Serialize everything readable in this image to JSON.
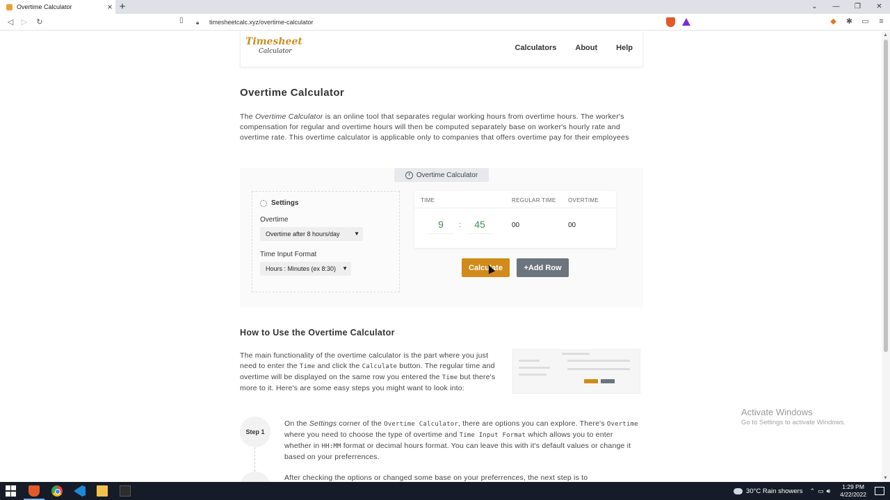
{
  "browser": {
    "tab_title": "Overtime Calculator",
    "tab_close": "×",
    "new_tab": "+",
    "url": "timesheetcalc.xyz/overtime-calculator",
    "window_controls": [
      "⌄",
      "—",
      "❐",
      "✕"
    ]
  },
  "site": {
    "logo_line1": "Timesheet",
    "logo_line2": "Calculator",
    "nav": [
      "Calculators",
      "About",
      "Help"
    ]
  },
  "page": {
    "title": "Overtime Calculator",
    "intro_prefix": "The ",
    "intro_em": "Overtime Calculator",
    "intro_rest": " is an online tool that separates regular working hours from overtime hours. The worker's compensation for regular and overtime hours will then be computed separately base on worker's hourly rate and overtime rate. This overtime calculator is applicable only to companies that offers overtime pay for their employees"
  },
  "calculator": {
    "tag_label": "Overtime Calculator",
    "settings_title": "Settings",
    "overtime_label": "Overtime",
    "overtime_value": "Overtime after 8 hours/day",
    "format_label": "Time Input Format",
    "format_value": "Hours : Minutes (ex 8:30)",
    "columns": [
      "TIME",
      "REGULAR TIME",
      "OVERTIME"
    ],
    "hours": "9",
    "minutes": "45",
    "separator": ":",
    "regular_time": "00",
    "overtime": "00",
    "calculate_label": "Calculate",
    "add_row_label": "+Add Row"
  },
  "howto": {
    "title": "How to Use the Overtime Calculator",
    "p1": "The main functionality of the overtime calculator is the part where you just need to enter the ",
    "code_time": "Time",
    "p2": " and click the ",
    "code_calculate": "Calculate",
    "p3": " button. The regular time and overtime will be displayed on the same row you entered the ",
    "p4": " but there's more to it. Here's are some easy steps you might want to look into:",
    "step1_label": "Step 1",
    "s1a": "On the ",
    "s1_settings": "Settings",
    "s1b": " corner of the ",
    "s1_code_calc": "Overtime Calculator",
    "s1c": ", there are options you can explore. There's ",
    "s1_code_overtime": "Overtime",
    "s1d": " where you need to choose the type of overtime and ",
    "s1_code_format": "Time Input Format",
    "s1e": " which allows you to enter whether in ",
    "s1_code_hhmm": "HH:MM",
    "s1f": " format or decimal hours format. You can leave this with it's default values or change it based on your preferrences.",
    "s2": "After checking the options or changed some base on your preferrences, the next step is to"
  },
  "watermark": {
    "line1": "Activate Windows",
    "line2": "Go to Settings to activate Windows."
  },
  "taskbar": {
    "weather": "30°C  Rain showers",
    "time": "1:29 PM",
    "date": "4/22/2022"
  },
  "colors": {
    "accent_orange": "#d18b19",
    "button_gray": "#6c747d",
    "time_green": "#3d8f56"
  }
}
